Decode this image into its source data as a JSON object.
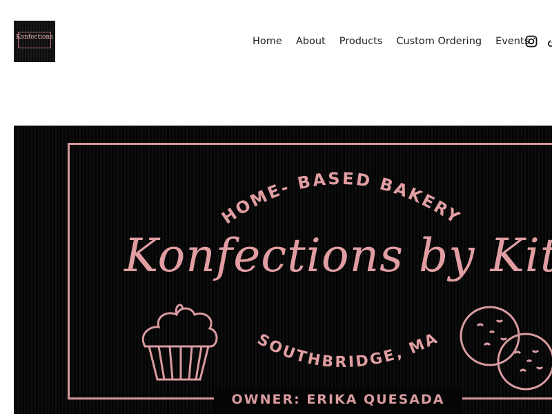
{
  "logo": {
    "text": "Konfections",
    "icon": "bakery-logo"
  },
  "nav": {
    "items": [
      "Home",
      "About",
      "Products",
      "Custom Ordering",
      "Events"
    ]
  },
  "social": {
    "icons": [
      "instagram-icon",
      "link-icon"
    ]
  },
  "hero": {
    "top_arc_text": "HOME- BASED BAKERY",
    "script_title": "Konfections by Kita",
    "bottom_arc_text": "SOUTHBRIDGE, MA",
    "owner_text": "OWNER: ERIKA QUESADA",
    "colors": {
      "background": "#050505",
      "accent": "#d89b9f"
    }
  }
}
